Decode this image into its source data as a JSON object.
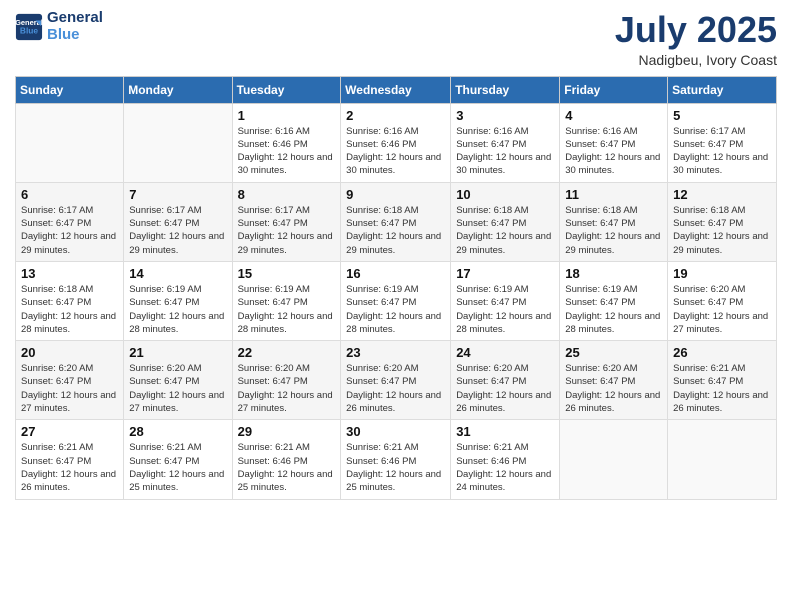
{
  "logo": {
    "line1": "General",
    "line2": "Blue"
  },
  "title": "July 2025",
  "location": "Nadigbeu, Ivory Coast",
  "weekdays": [
    "Sunday",
    "Monday",
    "Tuesday",
    "Wednesday",
    "Thursday",
    "Friday",
    "Saturday"
  ],
  "weeks": [
    [
      {
        "day": "",
        "sunrise": "",
        "sunset": "",
        "daylight": ""
      },
      {
        "day": "",
        "sunrise": "",
        "sunset": "",
        "daylight": ""
      },
      {
        "day": "1",
        "sunrise": "Sunrise: 6:16 AM",
        "sunset": "Sunset: 6:46 PM",
        "daylight": "Daylight: 12 hours and 30 minutes."
      },
      {
        "day": "2",
        "sunrise": "Sunrise: 6:16 AM",
        "sunset": "Sunset: 6:46 PM",
        "daylight": "Daylight: 12 hours and 30 minutes."
      },
      {
        "day": "3",
        "sunrise": "Sunrise: 6:16 AM",
        "sunset": "Sunset: 6:47 PM",
        "daylight": "Daylight: 12 hours and 30 minutes."
      },
      {
        "day": "4",
        "sunrise": "Sunrise: 6:16 AM",
        "sunset": "Sunset: 6:47 PM",
        "daylight": "Daylight: 12 hours and 30 minutes."
      },
      {
        "day": "5",
        "sunrise": "Sunrise: 6:17 AM",
        "sunset": "Sunset: 6:47 PM",
        "daylight": "Daylight: 12 hours and 30 minutes."
      }
    ],
    [
      {
        "day": "6",
        "sunrise": "Sunrise: 6:17 AM",
        "sunset": "Sunset: 6:47 PM",
        "daylight": "Daylight: 12 hours and 29 minutes."
      },
      {
        "day": "7",
        "sunrise": "Sunrise: 6:17 AM",
        "sunset": "Sunset: 6:47 PM",
        "daylight": "Daylight: 12 hours and 29 minutes."
      },
      {
        "day": "8",
        "sunrise": "Sunrise: 6:17 AM",
        "sunset": "Sunset: 6:47 PM",
        "daylight": "Daylight: 12 hours and 29 minutes."
      },
      {
        "day": "9",
        "sunrise": "Sunrise: 6:18 AM",
        "sunset": "Sunset: 6:47 PM",
        "daylight": "Daylight: 12 hours and 29 minutes."
      },
      {
        "day": "10",
        "sunrise": "Sunrise: 6:18 AM",
        "sunset": "Sunset: 6:47 PM",
        "daylight": "Daylight: 12 hours and 29 minutes."
      },
      {
        "day": "11",
        "sunrise": "Sunrise: 6:18 AM",
        "sunset": "Sunset: 6:47 PM",
        "daylight": "Daylight: 12 hours and 29 minutes."
      },
      {
        "day": "12",
        "sunrise": "Sunrise: 6:18 AM",
        "sunset": "Sunset: 6:47 PM",
        "daylight": "Daylight: 12 hours and 29 minutes."
      }
    ],
    [
      {
        "day": "13",
        "sunrise": "Sunrise: 6:18 AM",
        "sunset": "Sunset: 6:47 PM",
        "daylight": "Daylight: 12 hours and 28 minutes."
      },
      {
        "day": "14",
        "sunrise": "Sunrise: 6:19 AM",
        "sunset": "Sunset: 6:47 PM",
        "daylight": "Daylight: 12 hours and 28 minutes."
      },
      {
        "day": "15",
        "sunrise": "Sunrise: 6:19 AM",
        "sunset": "Sunset: 6:47 PM",
        "daylight": "Daylight: 12 hours and 28 minutes."
      },
      {
        "day": "16",
        "sunrise": "Sunrise: 6:19 AM",
        "sunset": "Sunset: 6:47 PM",
        "daylight": "Daylight: 12 hours and 28 minutes."
      },
      {
        "day": "17",
        "sunrise": "Sunrise: 6:19 AM",
        "sunset": "Sunset: 6:47 PM",
        "daylight": "Daylight: 12 hours and 28 minutes."
      },
      {
        "day": "18",
        "sunrise": "Sunrise: 6:19 AM",
        "sunset": "Sunset: 6:47 PM",
        "daylight": "Daylight: 12 hours and 28 minutes."
      },
      {
        "day": "19",
        "sunrise": "Sunrise: 6:20 AM",
        "sunset": "Sunset: 6:47 PM",
        "daylight": "Daylight: 12 hours and 27 minutes."
      }
    ],
    [
      {
        "day": "20",
        "sunrise": "Sunrise: 6:20 AM",
        "sunset": "Sunset: 6:47 PM",
        "daylight": "Daylight: 12 hours and 27 minutes."
      },
      {
        "day": "21",
        "sunrise": "Sunrise: 6:20 AM",
        "sunset": "Sunset: 6:47 PM",
        "daylight": "Daylight: 12 hours and 27 minutes."
      },
      {
        "day": "22",
        "sunrise": "Sunrise: 6:20 AM",
        "sunset": "Sunset: 6:47 PM",
        "daylight": "Daylight: 12 hours and 27 minutes."
      },
      {
        "day": "23",
        "sunrise": "Sunrise: 6:20 AM",
        "sunset": "Sunset: 6:47 PM",
        "daylight": "Daylight: 12 hours and 26 minutes."
      },
      {
        "day": "24",
        "sunrise": "Sunrise: 6:20 AM",
        "sunset": "Sunset: 6:47 PM",
        "daylight": "Daylight: 12 hours and 26 minutes."
      },
      {
        "day": "25",
        "sunrise": "Sunrise: 6:20 AM",
        "sunset": "Sunset: 6:47 PM",
        "daylight": "Daylight: 12 hours and 26 minutes."
      },
      {
        "day": "26",
        "sunrise": "Sunrise: 6:21 AM",
        "sunset": "Sunset: 6:47 PM",
        "daylight": "Daylight: 12 hours and 26 minutes."
      }
    ],
    [
      {
        "day": "27",
        "sunrise": "Sunrise: 6:21 AM",
        "sunset": "Sunset: 6:47 PM",
        "daylight": "Daylight: 12 hours and 26 minutes."
      },
      {
        "day": "28",
        "sunrise": "Sunrise: 6:21 AM",
        "sunset": "Sunset: 6:47 PM",
        "daylight": "Daylight: 12 hours and 25 minutes."
      },
      {
        "day": "29",
        "sunrise": "Sunrise: 6:21 AM",
        "sunset": "Sunset: 6:46 PM",
        "daylight": "Daylight: 12 hours and 25 minutes."
      },
      {
        "day": "30",
        "sunrise": "Sunrise: 6:21 AM",
        "sunset": "Sunset: 6:46 PM",
        "daylight": "Daylight: 12 hours and 25 minutes."
      },
      {
        "day": "31",
        "sunrise": "Sunrise: 6:21 AM",
        "sunset": "Sunset: 6:46 PM",
        "daylight": "Daylight: 12 hours and 24 minutes."
      },
      {
        "day": "",
        "sunrise": "",
        "sunset": "",
        "daylight": ""
      },
      {
        "day": "",
        "sunrise": "",
        "sunset": "",
        "daylight": ""
      }
    ]
  ]
}
